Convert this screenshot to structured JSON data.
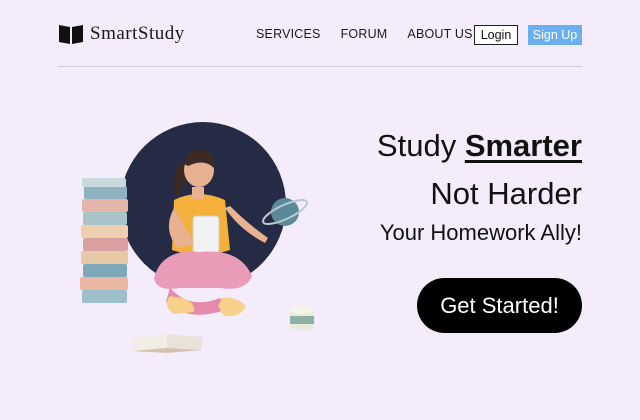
{
  "header": {
    "brand": "SmartStudy",
    "nav": [
      "SERVICES",
      "FORUM",
      "ABOUT US"
    ],
    "login_label": "Login",
    "signup_label": "Sign Up"
  },
  "hero": {
    "line1_prefix": "Study ",
    "line1_emphasis": "Smarter",
    "line2": "Not Harder",
    "line3": "Your Homework Ally!",
    "cta_label": "Get Started!"
  },
  "colors": {
    "background": "#f4ecfb",
    "signup_button": "#6ab0f0",
    "cta_button": "#000000",
    "illustration_circle": "#252b45"
  }
}
